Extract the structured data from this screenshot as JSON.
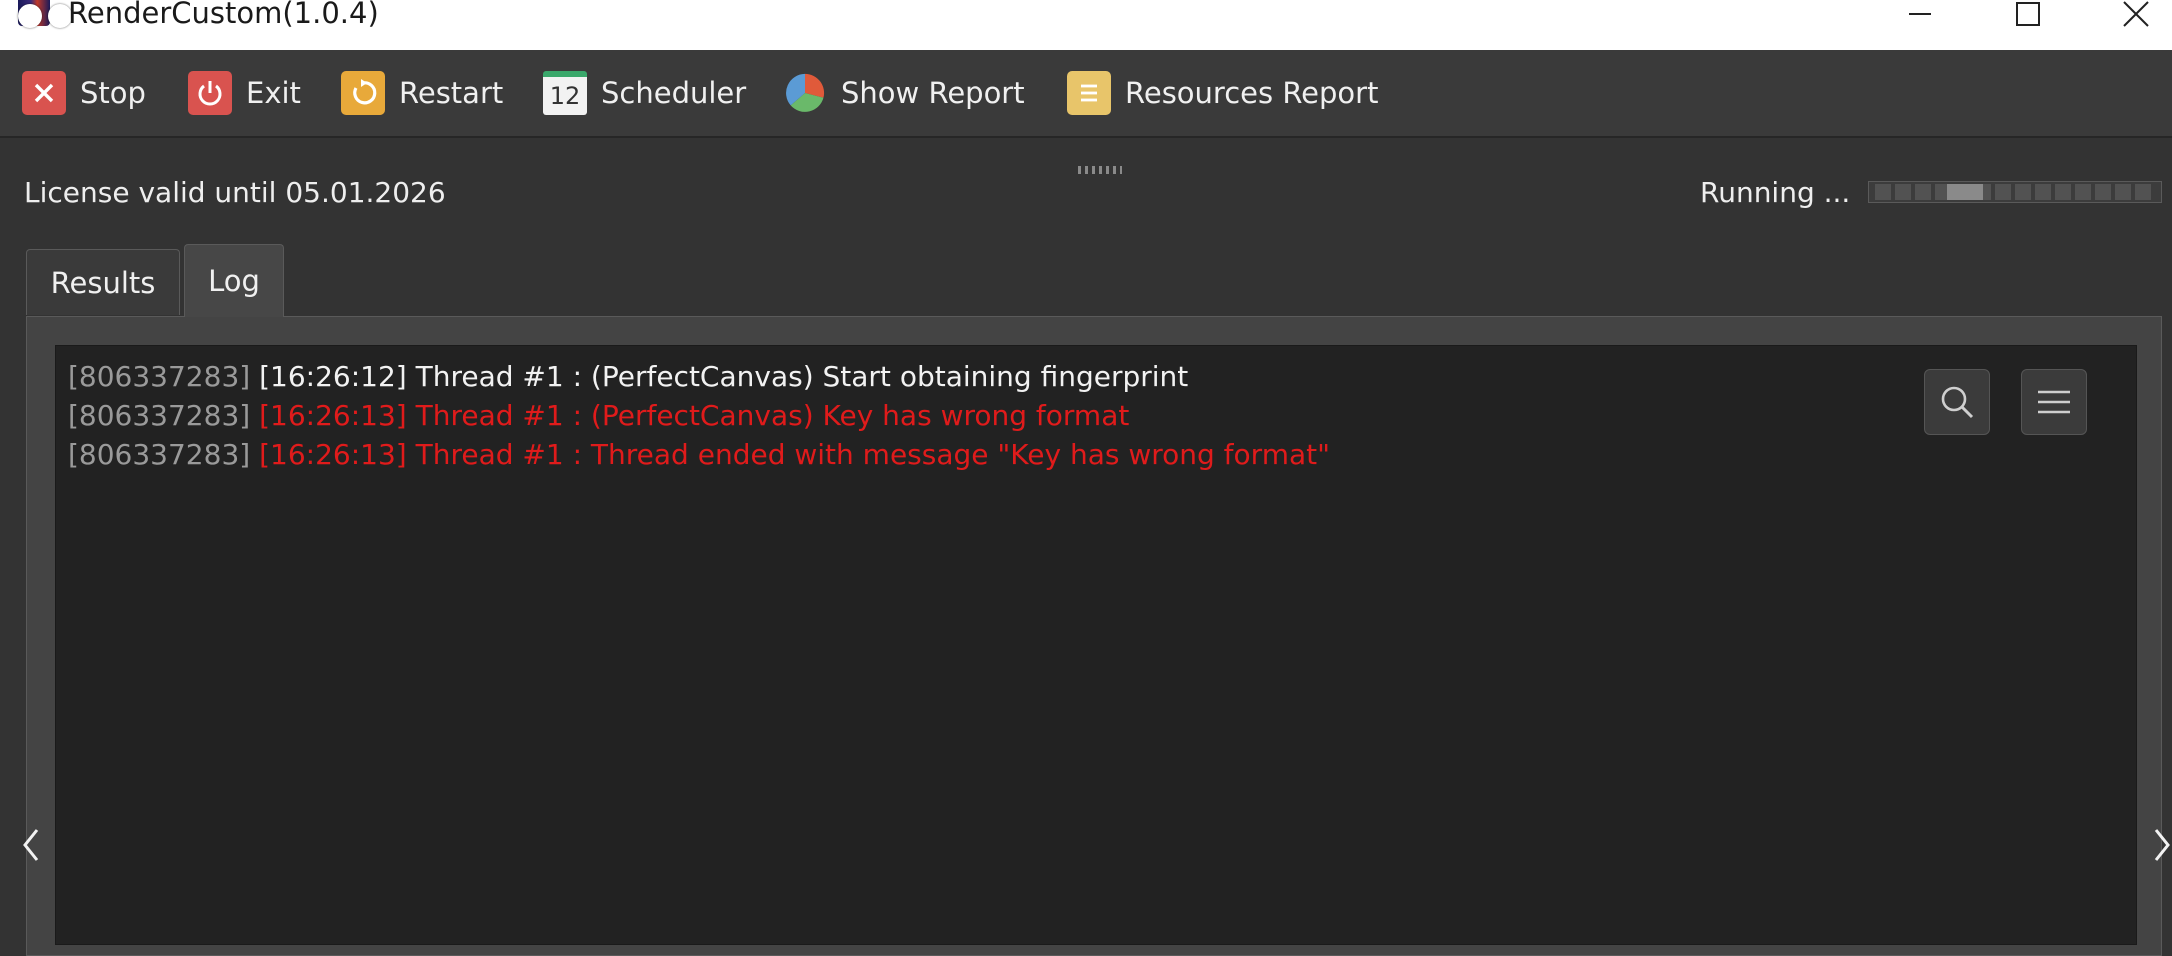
{
  "window": {
    "title": "RenderCustom(1.0.4)"
  },
  "toolbar": {
    "items": [
      {
        "label": "Stop",
        "icon": "stop-icon",
        "color": "#d9534f"
      },
      {
        "label": "Exit",
        "icon": "power-icon",
        "color": "#d9534f"
      },
      {
        "label": "Restart",
        "icon": "restart-icon",
        "color": "#e8a93a"
      },
      {
        "label": "Scheduler",
        "icon": "calendar-icon",
        "color": "#f2f2f2",
        "icon_text": "12"
      },
      {
        "label": "Show Report",
        "icon": "pie-chart-icon",
        "color": "#5b9bd5"
      },
      {
        "label": "Resources Report",
        "icon": "document-icon",
        "color": "#e8c56a"
      }
    ]
  },
  "status": {
    "license": "License valid until 05.01.2026",
    "running": "Running ..."
  },
  "tabs": [
    {
      "label": "Results",
      "active": false
    },
    {
      "label": "Log",
      "active": true
    }
  ],
  "log": {
    "lines": [
      {
        "id": "[806337283]",
        "message": "[16:26:12] Thread #1 : (PerfectCanvas) Start obtaining fingerprint",
        "level": "info"
      },
      {
        "id": "[806337283]",
        "message": "[16:26:13] Thread #1 : (PerfectCanvas) Key has wrong format",
        "level": "error"
      },
      {
        "id": "[806337283]",
        "message": "[16:26:13] Thread #1 : Thread ended with message \"Key has wrong format\"",
        "level": "error"
      }
    ],
    "colors": {
      "id": "#9a9a9a",
      "info": "#f2f2f2",
      "error": "#e01b1b"
    }
  },
  "tools": {
    "search_icon": "search-icon",
    "menu_icon": "menu-icon"
  }
}
